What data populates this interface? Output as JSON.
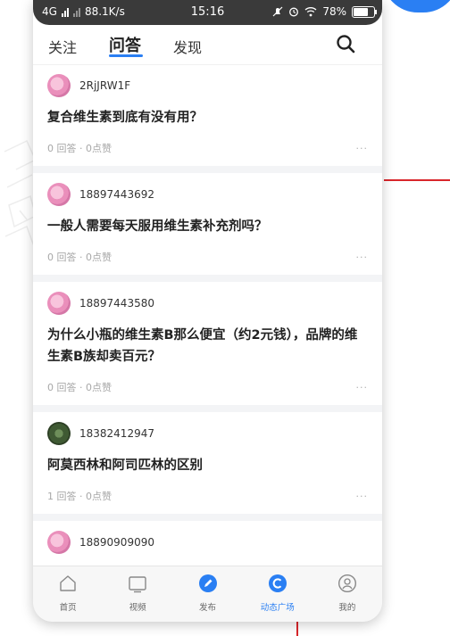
{
  "statusbar": {
    "network": "4G",
    "speed": "88.1K/s",
    "time": "15:16",
    "battery": "78%",
    "battery_level": 0.78
  },
  "topnav": {
    "tabs": [
      {
        "label": "关注"
      },
      {
        "label": "问答"
      },
      {
        "label": "发现"
      }
    ],
    "active_tab": "问答"
  },
  "posts": [
    {
      "user": "2RjJRW1F",
      "title": "复合维生素到底有没有用？",
      "meta": "0 回答 · 0点赞",
      "more": "···"
    },
    {
      "user": "18897443692",
      "title": "一般人需要每天服用维生素补充剂吗？",
      "meta": "0 回答 · 0点赞",
      "more": "···"
    },
    {
      "user": "18897443580",
      "title": "为什么小瓶的维生素B那么便宜（约2元钱），品牌的维生素B族却卖百元？",
      "meta": "0 回答 · 0点赞",
      "more": "···"
    },
    {
      "user": "18382412947",
      "title": "阿莫西林和阿司匹林的区别",
      "meta": "1 回答 · 0点赞",
      "more": "···"
    },
    {
      "user": "18890909090",
      "title": ""
    }
  ],
  "bottom_nav": [
    {
      "label": "首页"
    },
    {
      "label": "视频"
    },
    {
      "label": "发布"
    },
    {
      "label": "动态广场"
    },
    {
      "label": "我的"
    }
  ],
  "colors": {
    "accent": "#2a7ff3",
    "statusbar_bg": "#3a3a3a",
    "decor_red": "#d9262b"
  }
}
